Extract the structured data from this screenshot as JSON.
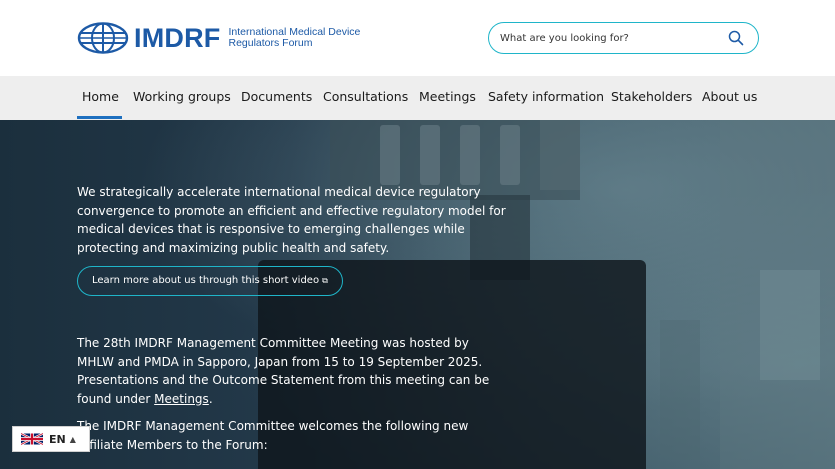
{
  "header": {
    "logo_word": "IMDRF",
    "logo_sub_line1": "International Medical Device",
    "logo_sub_line2": "Regulators Forum",
    "search_placeholder": "What are you looking for?",
    "brand_color": "#1d5aa6",
    "accent_color": "#1fb5c9"
  },
  "nav": {
    "items": [
      {
        "label": "Home"
      },
      {
        "label": "Working groups"
      },
      {
        "label": "Documents"
      },
      {
        "label": "Consultations"
      },
      {
        "label": "Meetings"
      },
      {
        "label": "Safety information"
      },
      {
        "label": "Stakeholders"
      },
      {
        "label": "About us"
      }
    ],
    "active": "Home"
  },
  "hero": {
    "intro_line1": "We strategically accelerate international medical device regulatory",
    "intro_line2": "convergence to promote an efficient and effective regulatory model for",
    "intro_line3": "medical devices that is responsive to emerging challenges while",
    "intro_line4": "protecting and maximizing public health and safety.",
    "cta_label": "Learn more about us through this short video",
    "cta_icon": "external-link-icon",
    "news_line1": "The 28th IMDRF Management Committee Meeting was hosted by",
    "news_line2": "MHLW and PMDA in Sapporo, Japan from 15 to 19 September 2025.",
    "news_line3": "Presentations and the Outcome Statement from this meeting can be",
    "news_line4_prefix": "found under ",
    "news_link": "Meetings",
    "news_line4_suffix": ".",
    "welcome_line1": "The IMDRF Management Committee welcomes the following new",
    "welcome_line2": "Affiliate Members to the Forum:"
  },
  "language": {
    "code": "EN",
    "flag": "uk-flag-icon"
  }
}
